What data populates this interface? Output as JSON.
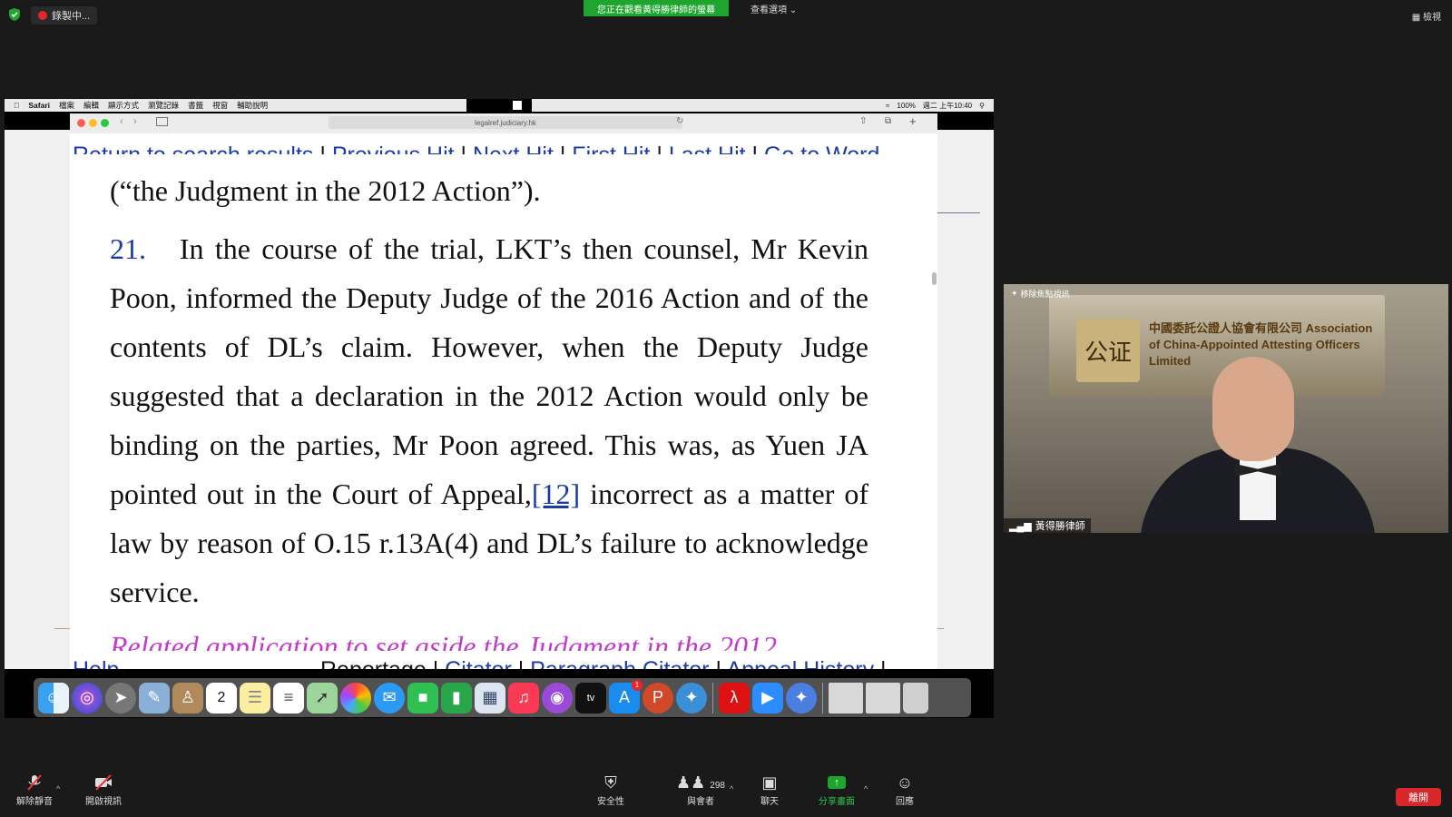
{
  "zoom_top": {
    "recording_label": "錄製中...",
    "viewing_banner": "您正在觀看黃得勝律師的螢幕",
    "view_options": "查看選項 ⌄",
    "view_mode": "▦ 檢視"
  },
  "mac_menu": {
    "items": [
      "Safari",
      "檔案",
      "編輯",
      "顯示方式",
      "瀏覽記錄",
      "書籤",
      "視窗",
      "輔助說明"
    ],
    "battery": "100%",
    "clock": "週二 上午10:40"
  },
  "browser": {
    "url": "legalref.judiciary.hk"
  },
  "document": {
    "nav_links": [
      "Return to search results",
      "Previous Hit",
      "Next Hit",
      "First Hit",
      "Last Hit",
      "Go to Word"
    ],
    "judgment_line": "(“the Judgment in the 2012 Action”).",
    "para_number": "21.",
    "para_text_1": "In the course of the trial, LKT’s then counsel, Mr Kevin Poon, informed the Deputy Judge of the 2016 Action and of the contents of DL’s claim.  However, when the Deputy Judge suggested that a declaration in the 2012 Action would only be binding on the parties, Mr Poon agreed.  This was, as Yuen JA pointed out in the Court of Appeal,",
    "footnote": "[12]",
    "para_text_2": " incorrect as a matter of law by reason of O.15 r.13A(4) and DL’s failure to acknowledge service.",
    "related_heading": "Related application to set aside the Judgment in the 2012",
    "help_link": "Help",
    "bottom_links": [
      "Reportage",
      "Citator",
      "Paragraph Citator",
      "Appeal History"
    ]
  },
  "dock": {
    "icons": [
      "finder-icon",
      "siri-icon",
      "launchpad-icon",
      "preview-icon",
      "contacts-icon",
      "calendar-icon",
      "notes-icon",
      "reminders-icon",
      "maps-icon",
      "photos-icon",
      "messages-icon",
      "facetime-icon",
      "numbers-icon",
      "keynote-icon",
      "music-icon",
      "podcasts-icon",
      "appletv-icon",
      "appstore-icon",
      "powerpoint-icon",
      "safari-icon",
      "acrobat-icon",
      "zoom-icon",
      "safari-tp-icon",
      "screenshot-icon",
      "screenshot2-icon",
      "trash-icon"
    ],
    "calendar_day": "2",
    "appstore_badge": "1"
  },
  "video": {
    "pin_label": "移除焦點視訊",
    "participant_name": "黃得勝律師",
    "sign_text": "中國委託公證人協會有限公司 Association of China-Appointed Attesting Officers Limited",
    "logo_glyph": "公证"
  },
  "toolbar": {
    "unmute": "解除靜音",
    "start_video": "開啟視訊",
    "security": "安全性",
    "participants": "與會者",
    "participants_count": "298",
    "chat": "聊天",
    "share_screen": "分享畫面",
    "reactions": "回應",
    "leave": "離開"
  }
}
